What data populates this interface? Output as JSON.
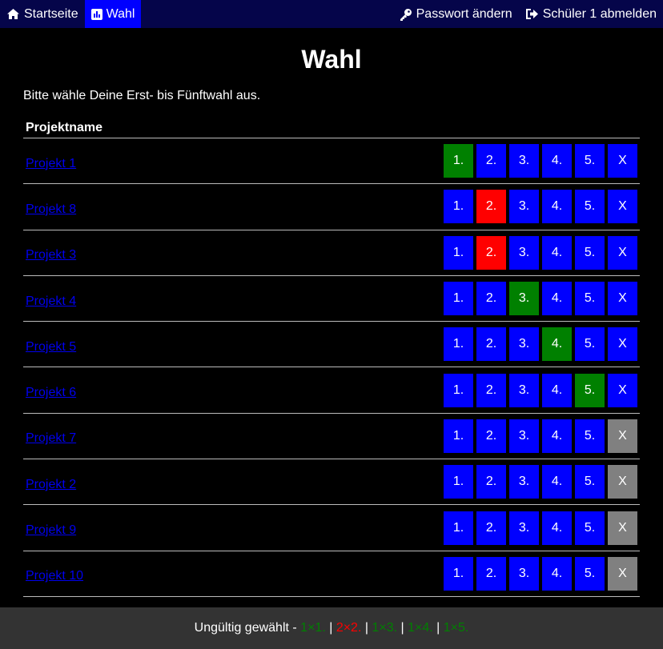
{
  "nav": {
    "home_label": "Startseite",
    "vote_label": "Wahl",
    "password_label": "Passwort ändern",
    "logout_label": "Schüler 1 abmelden"
  },
  "page": {
    "title": "Wahl",
    "intro": "Bitte wähle Deine Erst- bis Fünftwahl aus.",
    "column_header": "Projektname"
  },
  "choice_labels": [
    "1.",
    "2.",
    "3.",
    "4.",
    "5.",
    "X"
  ],
  "projects": [
    {
      "name": "Projekt 1",
      "selected": 0,
      "state": "ok"
    },
    {
      "name": "Projekt 8",
      "selected": 1,
      "state": "bad"
    },
    {
      "name": "Projekt 3",
      "selected": 1,
      "state": "bad"
    },
    {
      "name": "Projekt 4",
      "selected": 2,
      "state": "ok"
    },
    {
      "name": "Projekt 5",
      "selected": 3,
      "state": "ok"
    },
    {
      "name": "Projekt 6",
      "selected": 4,
      "state": "ok"
    },
    {
      "name": "Projekt 7",
      "selected": 5,
      "state": "none"
    },
    {
      "name": "Projekt 2",
      "selected": 5,
      "state": "none"
    },
    {
      "name": "Projekt 9",
      "selected": 5,
      "state": "none"
    },
    {
      "name": "Projekt 10",
      "selected": 5,
      "state": "none"
    }
  ],
  "footer": {
    "prefix": "Ungültig gewählt - ",
    "separator": " | ",
    "items": [
      {
        "text": "1×1.",
        "state": "ok"
      },
      {
        "text": "2×2.",
        "state": "bad"
      },
      {
        "text": "1×3.",
        "state": "ok"
      },
      {
        "text": "1×4.",
        "state": "ok"
      },
      {
        "text": "1×5.",
        "state": "ok"
      }
    ]
  },
  "colors": {
    "navbar": "#05054a",
    "active_tab": "#0000ff",
    "choice_default": "#0000ff",
    "choice_ok": "#008000",
    "choice_bad": "#ff0000",
    "choice_none": "#808080",
    "footer_bg": "#333333"
  },
  "icons": {
    "home": "home-icon",
    "vote": "bar-chart-icon",
    "password": "key-icon",
    "logout": "sign-out-icon"
  }
}
